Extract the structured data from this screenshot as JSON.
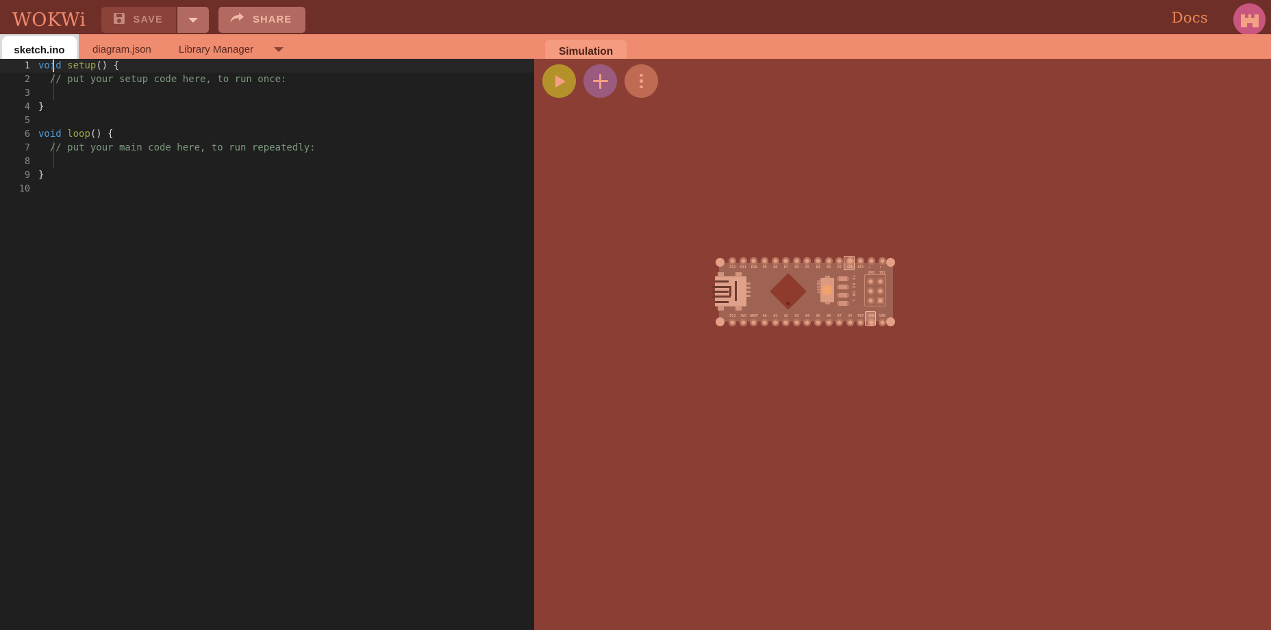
{
  "app": {
    "logo": "WOKWi",
    "background_color": "#8b3f34",
    "topbar_color": "#6e2f28",
    "accent_color": "#ef8b6e"
  },
  "toolbar": {
    "save_label": "SAVE",
    "save_icon": "floppy-disk-icon",
    "save_caret_icon": "chevron-down-icon",
    "share_label": "SHARE",
    "share_icon": "share-arrow-icon",
    "docs_label": "Docs",
    "avatar_icon": "user-avatar"
  },
  "tabs": {
    "items": [
      {
        "label": "sketch.ino",
        "active": true
      },
      {
        "label": "diagram.json",
        "active": false
      },
      {
        "label": "Library Manager",
        "active": false
      }
    ],
    "overflow_icon": "chevron-down-icon"
  },
  "simulation": {
    "tab_label": "Simulation",
    "controls": [
      {
        "name": "play-button",
        "icon": "play-icon",
        "color": "#b5912c"
      },
      {
        "name": "add-part-button",
        "icon": "plus-icon",
        "color": "#9b5b7e"
      },
      {
        "name": "more-menu-button",
        "icon": "kebab-menu-icon",
        "color": "#bf6a53"
      }
    ]
  },
  "editor": {
    "filename": "sketch.ino",
    "cursor_line": 1,
    "lines": [
      {
        "n": "1",
        "tokens": [
          {
            "t": "void ",
            "c": "kw"
          },
          {
            "t": "setup",
            "c": "fn"
          },
          {
            "t": "() {",
            "c": "pn"
          }
        ],
        "indent_guide": false,
        "cursor": true
      },
      {
        "n": "2",
        "tokens": [
          {
            "t": "  // put your setup code here, to run once:",
            "c": "cm"
          }
        ],
        "indent_guide": true,
        "cursor": false
      },
      {
        "n": "3",
        "tokens": [
          {
            "t": "",
            "c": "pn"
          }
        ],
        "indent_guide": true,
        "cursor": false
      },
      {
        "n": "4",
        "tokens": [
          {
            "t": "}",
            "c": "pn"
          }
        ],
        "indent_guide": false,
        "cursor": false
      },
      {
        "n": "5",
        "tokens": [
          {
            "t": "",
            "c": "pn"
          }
        ],
        "indent_guide": false,
        "cursor": false
      },
      {
        "n": "6",
        "tokens": [
          {
            "t": "void ",
            "c": "kw"
          },
          {
            "t": "loop",
            "c": "fn"
          },
          {
            "t": "() {",
            "c": "pn"
          }
        ],
        "indent_guide": false,
        "cursor": false
      },
      {
        "n": "7",
        "tokens": [
          {
            "t": "  // put your main code here, to run repeatedly:",
            "c": "cm"
          }
        ],
        "indent_guide": true,
        "cursor": false
      },
      {
        "n": "8",
        "tokens": [
          {
            "t": "",
            "c": "pn"
          }
        ],
        "indent_guide": true,
        "cursor": false
      },
      {
        "n": "9",
        "tokens": [
          {
            "t": "}",
            "c": "pn"
          }
        ],
        "indent_guide": false,
        "cursor": false
      },
      {
        "n": "10",
        "tokens": [
          {
            "t": "",
            "c": "pn"
          }
        ],
        "indent_guide": false,
        "cursor": false
      }
    ]
  },
  "board": {
    "name": "Arduino Nano",
    "top_pins": [
      "D12",
      "D11",
      "D10",
      "D9",
      "D8",
      "D7",
      "D6",
      "D5",
      "D4",
      "D3",
      "D2",
      "GND",
      "RST",
      "↓\nRX0",
      "↑\nTX1"
    ],
    "top_pins_highlighted": [
      "GND"
    ],
    "bottom_pins": [
      "D13",
      "3V3",
      "AREF",
      "A0",
      "A1",
      "A2",
      "A3",
      "A4",
      "A5",
      "A6",
      "A7",
      "5V",
      "RST",
      "GND",
      "VIN"
    ],
    "bottom_pins_highlighted": [
      "GND"
    ],
    "led_labels": [
      "TX",
      "RX",
      "ON",
      "L"
    ],
    "reset_label": "RESET",
    "usb_connector": "mini-usb-icon",
    "icsp_header": "icsp-header"
  }
}
